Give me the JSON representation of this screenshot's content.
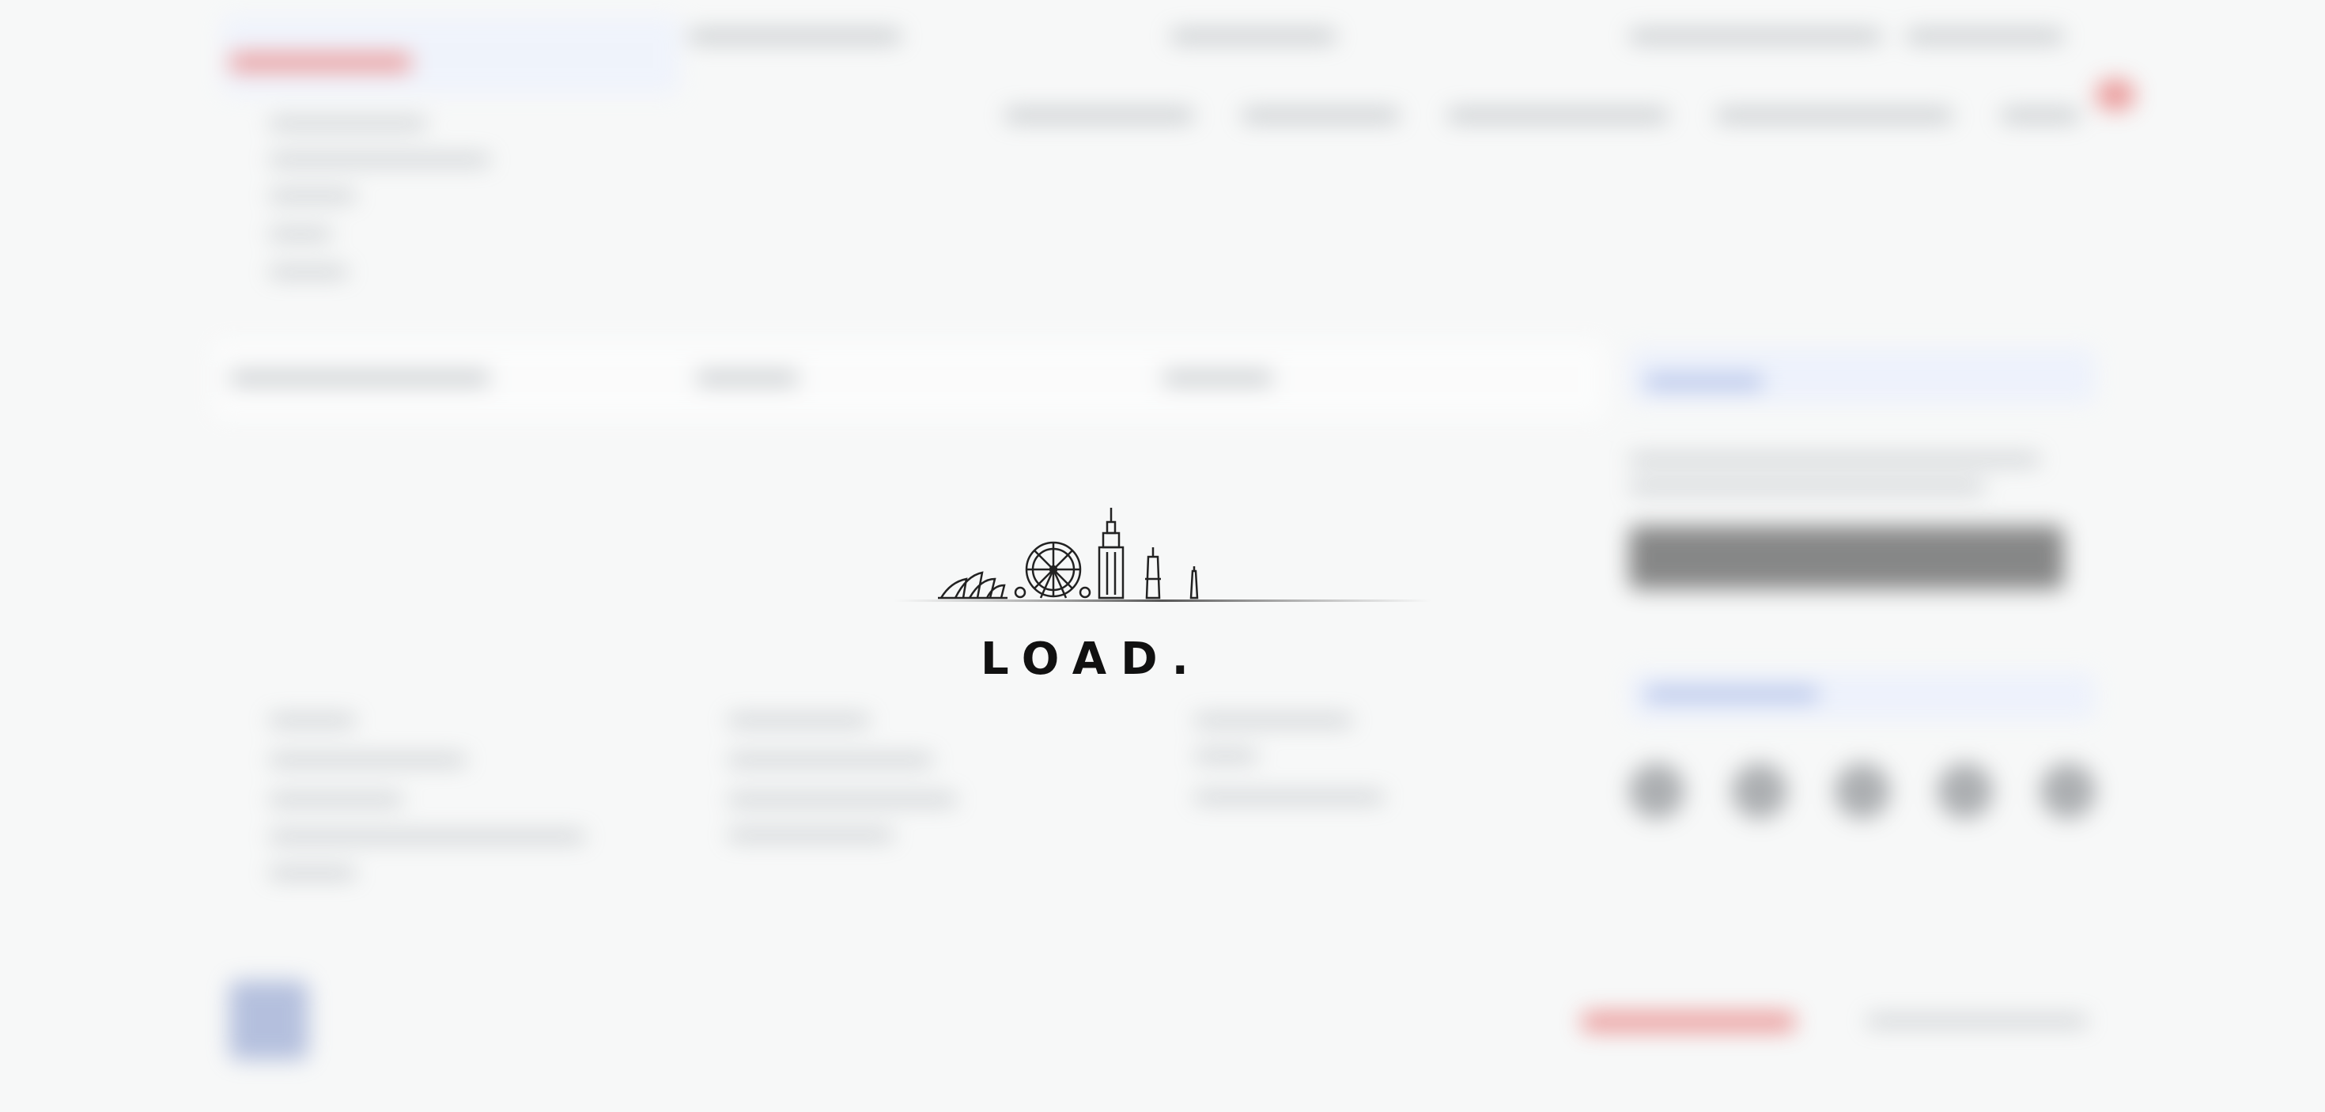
{
  "loader": {
    "text": "LOAD.",
    "icon": "city-skyline-icon"
  },
  "colors": {
    "background": "#f7f8f8",
    "loader_text": "#111111",
    "brand_red": "#e04a4a",
    "brand_blue": "#6f8bd6"
  }
}
